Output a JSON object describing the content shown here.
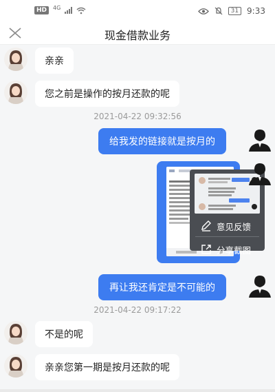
{
  "status_bar": {
    "hd": "HD",
    "network": "4G",
    "battery": "31",
    "time": "9:33"
  },
  "header": {
    "title": "现金借款业务"
  },
  "messages": [
    {
      "side": "left",
      "text": "亲亲"
    },
    {
      "side": "left",
      "text": "您之前是操作的按月还款的呢"
    },
    {
      "type": "timestamp",
      "text": "2021-04-22 09:32:56"
    },
    {
      "side": "right",
      "text": "给我发的链接就是按月的"
    },
    {
      "side": "right",
      "type": "image"
    },
    {
      "side": "right",
      "text": "再让我还肯定是不可能的"
    },
    {
      "type": "timestamp",
      "text": "2021-04-22 09:17:22"
    },
    {
      "side": "left",
      "text": "不是的呢"
    },
    {
      "side": "left",
      "text": "亲亲您第一期是按月还款的呢"
    }
  ],
  "context_menu": {
    "feedback": "意见反馈",
    "share": "分享截图"
  },
  "colors": {
    "accent": "#3d7cf0",
    "background": "#f5f6f7",
    "menu_bg": "#4a4d52"
  }
}
